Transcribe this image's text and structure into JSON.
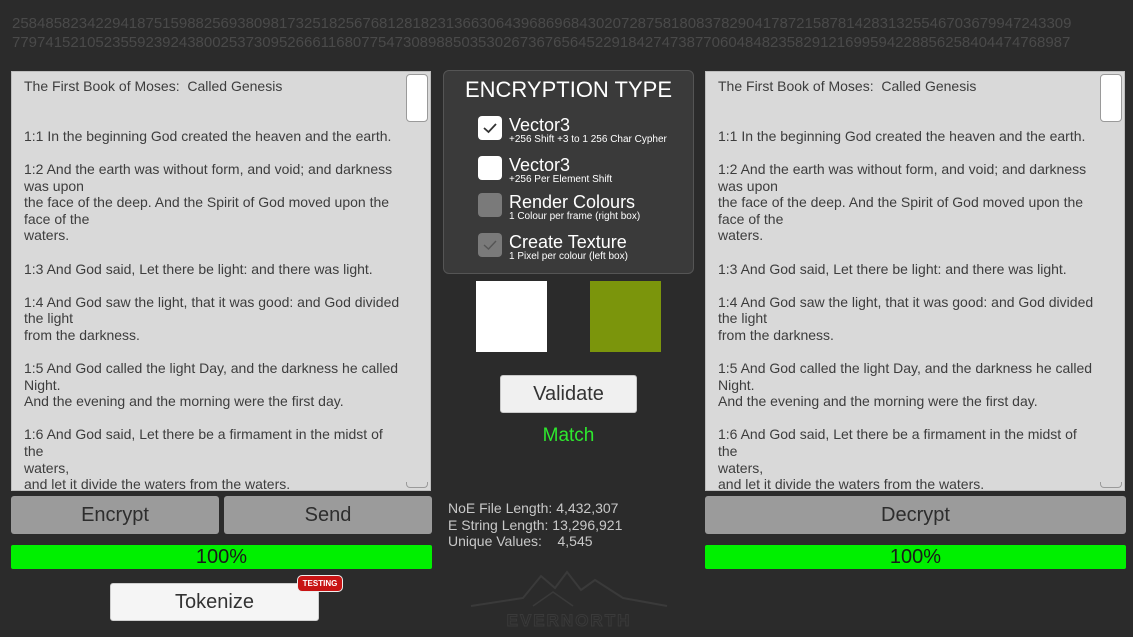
{
  "header": {
    "digits_line1": "2584858234229418751598825693809817325182567681281823136630643968696843020728758180837829041787215878142831325546703679947243309",
    "digits_line2": "7797415210523559239243800253730952666116807754730898850353026736765645229184274738770604848235829121699594228856258404474768987"
  },
  "left_panel": {
    "text": "The First Book of Moses:  Called Genesis\n\n\n1:1 In the beginning God created the heaven and the earth.\n\n1:2 And the earth was without form, and void; and darkness\nwas upon\nthe face of the deep. And the Spirit of God moved upon the\nface of the\nwaters.\n\n1:3 And God said, Let there be light: and there was light.\n\n1:4 And God saw the light, that it was good: and God divided\nthe light\nfrom the darkness.\n\n1:5 And God called the light Day, and the darkness he called\nNight.\nAnd the evening and the morning were the first day.\n\n1:6 And God said, Let there be a firmament in the midst of the\nwaters,\nand let it divide the waters from the waters."
  },
  "right_panel": {
    "text": "The First Book of Moses:  Called Genesis\n\n\n1:1 In the beginning God created the heaven and the earth.\n\n1:2 And the earth was without form, and void; and darkness\nwas upon\nthe face of the deep. And the Spirit of God moved upon the\nface of the\nwaters.\n\n1:3 And God said, Let there be light: and there was light.\n\n1:4 And God saw the light, that it was good: and God divided\nthe light\nfrom the darkness.\n\n1:5 And God called the light Day, and the darkness he called\nNight.\nAnd the evening and the morning were the first day.\n\n1:6 And God said, Let there be a firmament in the midst of the\nwaters,\nand let it divide the waters from the waters."
  },
  "encryption": {
    "title": "ENCRYPTION TYPE",
    "options": [
      {
        "label": "Vector3",
        "sub": "+256 Shift +3 to 1 256 Char Cypher",
        "checked": true,
        "enabled": true
      },
      {
        "label": "Vector3",
        "sub": "+256 Per Element Shift",
        "checked": false,
        "enabled": true
      },
      {
        "label": "Render Colours",
        "sub": "1 Colour per frame (right box)",
        "checked": false,
        "enabled": false
      },
      {
        "label": "Create Texture",
        "sub": "1 Pixel per colour (left box)",
        "checked": true,
        "enabled": false
      }
    ]
  },
  "swatches": {
    "left_color": "#ffffff",
    "right_color": "#7b950c"
  },
  "buttons": {
    "encrypt": "Encrypt",
    "send": "Send",
    "decrypt": "Decrypt",
    "validate": "Validate",
    "tokenize": "Tokenize"
  },
  "status": {
    "match": "Match",
    "match_color": "#2ee82e"
  },
  "progress": {
    "left_label": "100%",
    "left_value": 1.0,
    "right_label": "100%",
    "right_value": 1.0,
    "color": "#00f000"
  },
  "stats": {
    "file_length_label": "NoE File Length:",
    "file_length_value": "4,432,307",
    "string_length_label": "E String Length:",
    "string_length_value": "13,296,921",
    "unique_label": "Unique Values:",
    "unique_value": "4,545"
  },
  "badge": {
    "label": "TESTING"
  },
  "logo": {
    "text": "EVERNORTH"
  }
}
